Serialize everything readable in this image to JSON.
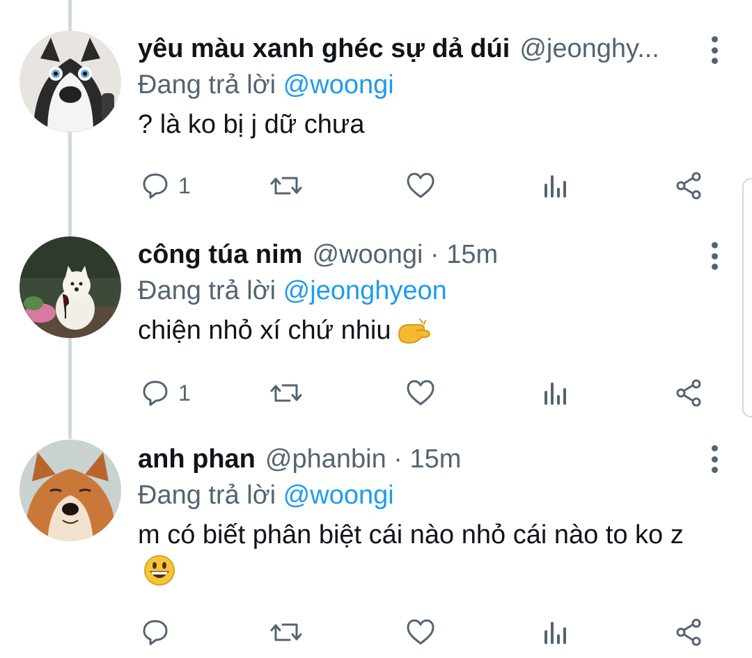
{
  "tweets": [
    {
      "display_name": "yêu màu xanh ghéc sự dả dúi",
      "handle": "@jeonghy...",
      "time": "",
      "reply_prefix": "Đang trả lời",
      "reply_to": "@woongi",
      "text": "? là ko bị j dữ chưa",
      "emoji": "",
      "reply_count": "1",
      "avatar": "husky-avatar"
    },
    {
      "display_name": "công túa nim",
      "handle": "@woongi",
      "time": "· 15m",
      "reply_prefix": "Đang trả lời",
      "reply_to": "@jeonghyeon",
      "text": "chiện nhỏ xí chứ nhiu",
      "emoji": "pinching-hand-emoji",
      "reply_count": "1",
      "avatar": "dog-with-wine-avatar"
    },
    {
      "display_name": "anh phan",
      "handle": "@phanbin",
      "time": "· 15m",
      "reply_prefix": "Đang trả lời",
      "reply_to": "@woongi",
      "text": "m có biết phân biệt cái nào nhỏ cái nào to ko z",
      "emoji": "grinning-face-emoji",
      "reply_count": "",
      "avatar": "fox-avatar"
    }
  ],
  "colors": {
    "accent": "#1d9bf0",
    "secondary_text": "#536471",
    "thread_line": "#cfd9de"
  },
  "action_icons": [
    "reply-icon",
    "retweet-icon",
    "like-icon",
    "analytics-icon",
    "share-icon"
  ]
}
